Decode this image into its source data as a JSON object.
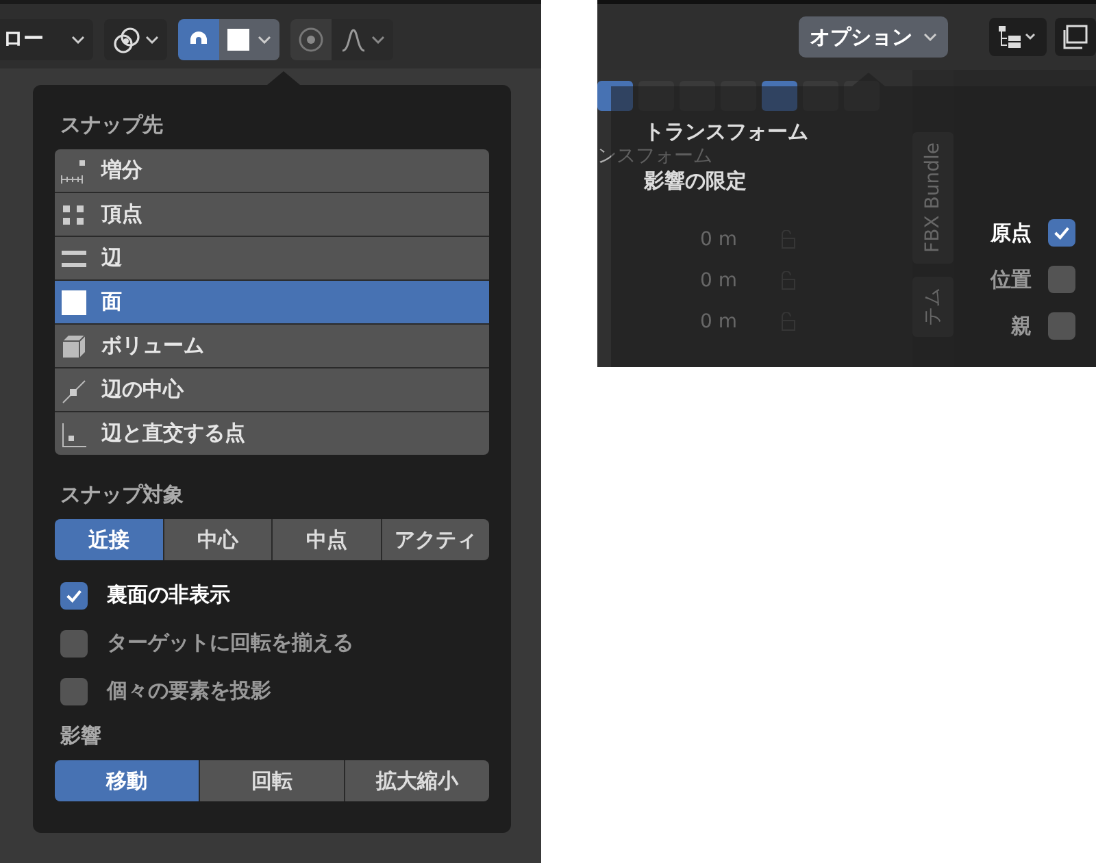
{
  "left_panel": {
    "header": {
      "mode_dropdown": "ロー"
    },
    "snap_popup": {
      "snap_to_heading": "スナップ先",
      "snap_to": [
        {
          "label": "増分",
          "kind": "increment",
          "selected": false
        },
        {
          "label": "頂点",
          "kind": "vertex",
          "selected": false
        },
        {
          "label": "辺",
          "kind": "edge",
          "selected": false
        },
        {
          "label": "面",
          "kind": "face",
          "selected": true
        },
        {
          "label": "ボリューム",
          "kind": "volume",
          "selected": false
        },
        {
          "label": "辺の中心",
          "kind": "midpoint",
          "selected": false
        },
        {
          "label": "辺と直交する点",
          "kind": "perpendicular",
          "selected": false
        }
      ],
      "snap_with_heading": "スナップ対象",
      "snap_with": [
        {
          "label": "近接",
          "selected": true
        },
        {
          "label": "中心",
          "selected": false
        },
        {
          "label": "中点",
          "selected": false
        },
        {
          "label": "アクティ",
          "selected": false
        }
      ],
      "options": [
        {
          "label": "裏面の非表示",
          "checked": true
        },
        {
          "label": "ターゲットに回転を揃える",
          "checked": false
        },
        {
          "label": "個々の要素を投影",
          "checked": false
        }
      ],
      "affect_heading": "影響",
      "affect": [
        {
          "label": "移動",
          "selected": true
        },
        {
          "label": "回転",
          "selected": false
        },
        {
          "label": "拡大縮小",
          "selected": false
        }
      ]
    }
  },
  "right_panel": {
    "options_button": "オプション",
    "background": {
      "panel_title": "ンスフォーム",
      "values": [
        "0 m",
        "0 m",
        "0 m"
      ],
      "side_tabs": [
        "FBX Bundle",
        "テム"
      ]
    },
    "options_popup": {
      "items": [
        "トランスフォーム",
        "影響の限定"
      ],
      "checkboxes": [
        {
          "label": "原点",
          "checked": true
        },
        {
          "label": "位置",
          "checked": false
        },
        {
          "label": "親",
          "checked": false
        }
      ]
    }
  }
}
